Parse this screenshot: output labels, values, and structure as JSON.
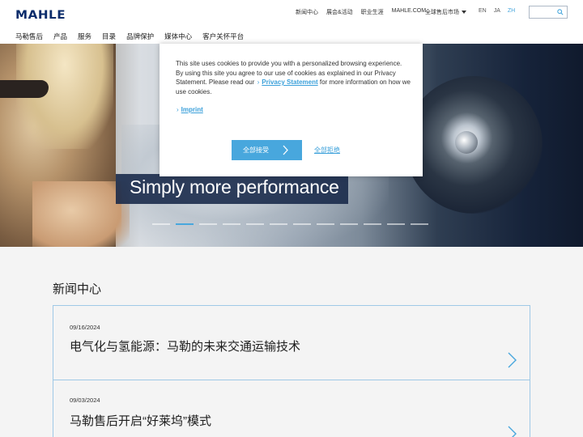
{
  "header": {
    "logo": "MAHLE",
    "top_links": [
      "新闻中心",
      "展会&活动",
      "职业生涯",
      "MAHLE.COM"
    ],
    "market_selector": "全球售后市场",
    "languages": [
      "EN",
      "JA",
      "ZH"
    ],
    "active_language": "ZH",
    "search": {
      "value": "",
      "placeholder": ""
    },
    "main_nav": [
      "马勒售后",
      "产品",
      "服务",
      "目录",
      "品牌保护",
      "媒体中心",
      "客户关怀平台"
    ]
  },
  "hero": {
    "title": "Simply more performance",
    "slides_total": 12,
    "active_slide": 2
  },
  "news": {
    "heading": "新闻中心",
    "items": [
      {
        "date": "09/16/2024",
        "title": "电气化与氢能源：马勒的未来交通运输技术"
      },
      {
        "date": "09/03/2024",
        "title": "马勒售后开启“好莱坞”模式"
      }
    ]
  },
  "cookie_dialog": {
    "text_part1": "This site uses cookies to provide you with a personalized browsing experience. By using this site you agree to our use of cookies as explained in our Privacy Statement. Please read our",
    "privacy_link": "Privacy Statement",
    "text_part2": "for more information on how we use cookies.",
    "imprint_link": "Imprint",
    "accept_button": "全部接受",
    "reject_link": "全部拒绝"
  },
  "colors": {
    "accent": "#48a7dd",
    "brand_navy": "#0b2c6b",
    "hero_title_bg": "#162748"
  }
}
